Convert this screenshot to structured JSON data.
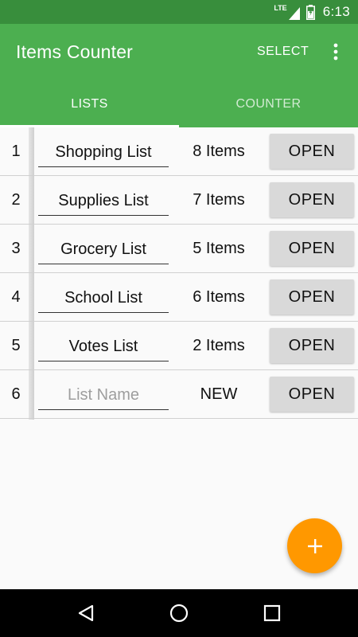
{
  "status_bar": {
    "network_label": "LTE",
    "battery_level": 0.7,
    "time": "6:13"
  },
  "app_bar": {
    "title": "Items Counter",
    "select_label": "SELECT",
    "menu_icon": "more-vert-icon",
    "background_color": "#4caf50",
    "status_color": "#388e3c"
  },
  "tabs": [
    {
      "label": "LISTS",
      "active": true
    },
    {
      "label": "COUNTER",
      "active": false
    }
  ],
  "lists": [
    {
      "index": "1",
      "name": "Shopping List",
      "placeholder": "List Name",
      "count": "8 Items",
      "action": "OPEN"
    },
    {
      "index": "2",
      "name": "Supplies List",
      "placeholder": "List Name",
      "count": "7 Items",
      "action": "OPEN"
    },
    {
      "index": "3",
      "name": "Grocery List",
      "placeholder": "List Name",
      "count": "5 Items",
      "action": "OPEN"
    },
    {
      "index": "4",
      "name": "School List",
      "placeholder": "List Name",
      "count": "6 Items",
      "action": "OPEN"
    },
    {
      "index": "5",
      "name": "Votes List",
      "placeholder": "List Name",
      "count": "2 Items",
      "action": "OPEN"
    },
    {
      "index": "6",
      "name": "",
      "placeholder": "List Name",
      "count": "NEW",
      "action": "OPEN"
    }
  ],
  "fab": {
    "icon": "plus-icon",
    "color": "#ff9800"
  },
  "nav_bar": {
    "back_icon": "back-triangle-icon",
    "home_icon": "home-circle-icon",
    "recents_icon": "recents-square-icon"
  }
}
